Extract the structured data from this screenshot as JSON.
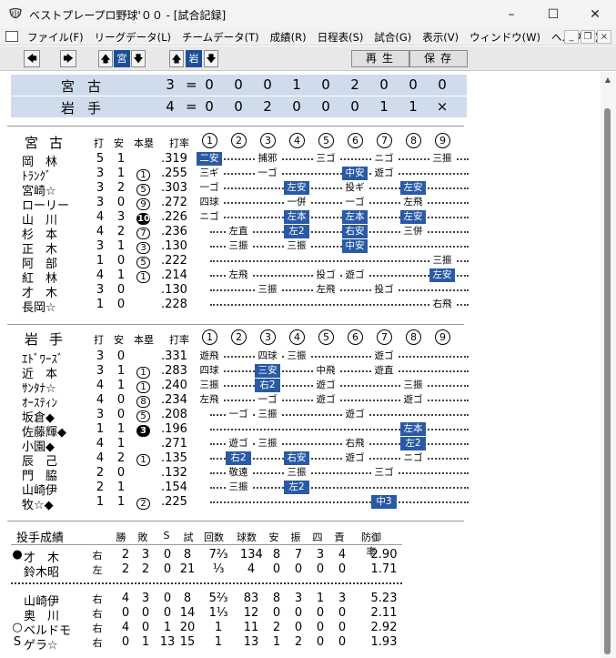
{
  "window": {
    "title": "ベストプレープロ野球'００ - [試合記録]"
  },
  "menu": [
    "ファイル(F)",
    "リーグデータ(L)",
    "チームデータ(T)",
    "成績(R)",
    "日程表(S)",
    "試合(G)",
    "表示(V)",
    "ウィンドウ(W)",
    "ヘルプ(H)"
  ],
  "toolbar": {
    "team_a": "宮",
    "team_b": "岩",
    "play": "再生",
    "save": "保存"
  },
  "score": {
    "rows": [
      {
        "team": "宮古",
        "runs": "3",
        "eq": "=",
        "innings": [
          "0",
          "0",
          "0",
          "1",
          "0",
          "2",
          "0",
          "0",
          "0"
        ]
      },
      {
        "team": "岩手",
        "runs": "4",
        "eq": "=",
        "innings": [
          "0",
          "0",
          "2",
          "0",
          "0",
          "0",
          "1",
          "1",
          "×"
        ]
      }
    ]
  },
  "batting_headers": {
    "ab": "打",
    "h": "安",
    "hr": "本塁",
    "avg": "打率",
    "innings": [
      "1",
      "2",
      "3",
      "4",
      "5",
      "6",
      "7",
      "8",
      "9"
    ]
  },
  "team1": {
    "name": "宮古",
    "players": [
      {
        "name": "岡　林",
        "ab": "5",
        "h": "1",
        "hr": "",
        "avg": ".319",
        "res": [
          {
            "inn": 1,
            "t": "二安",
            "hit": true
          },
          {
            "inn": 3,
            "t": "捕邪"
          },
          {
            "inn": 5,
            "t": "三ゴ"
          },
          {
            "inn": 7,
            "t": "ニゴ"
          },
          {
            "inn": 9,
            "t": "三振"
          }
        ]
      },
      {
        "name": "ﾄﾗﾝｸﾞ",
        "ab": "3",
        "h": "1",
        "hr": "1",
        "avg": ".255",
        "res": [
          {
            "inn": 1,
            "t": "三ギ"
          },
          {
            "inn": 3,
            "t": "一ゴ"
          },
          {
            "inn": 6,
            "t": "中安",
            "hit": true
          },
          {
            "inn": 7,
            "t": "遊ゴ"
          }
        ]
      },
      {
        "name": "宮崎☆",
        "ab": "3",
        "h": "2",
        "hr": "5",
        "avg": ".303",
        "res": [
          {
            "inn": 1,
            "t": "一ゴ"
          },
          {
            "inn": 4,
            "t": "左安",
            "hit": true
          },
          {
            "inn": 6,
            "t": "投ギ"
          },
          {
            "inn": 8,
            "t": "左安",
            "hit": true
          }
        ]
      },
      {
        "name": "ローリー",
        "ab": "3",
        "h": "0",
        "hr": "9",
        "avg": ".272",
        "res": [
          {
            "inn": 1,
            "t": "四球"
          },
          {
            "inn": 4,
            "t": "一併"
          },
          {
            "inn": 6,
            "t": "一ゴ"
          },
          {
            "inn": 8,
            "t": "左飛"
          }
        ]
      },
      {
        "name": "山　川",
        "ab": "4",
        "h": "3",
        "hr": "10",
        "hrBlack": true,
        "avg": ".226",
        "res": [
          {
            "inn": 1,
            "t": "ニゴ"
          },
          {
            "inn": 4,
            "t": "左本",
            "hit": true
          },
          {
            "inn": 6,
            "t": "左本",
            "hit": true
          },
          {
            "inn": 8,
            "t": "左安",
            "hit": true
          }
        ]
      },
      {
        "name": "杉　本",
        "ab": "4",
        "h": "2",
        "hr": "7",
        "avg": ".236",
        "res": [
          {
            "inn": 2,
            "t": "左直"
          },
          {
            "inn": 4,
            "t": "左2",
            "hit": true
          },
          {
            "inn": 6,
            "t": "右安",
            "hit": true
          },
          {
            "inn": 8,
            "t": "三併"
          }
        ]
      },
      {
        "name": "正　木",
        "ab": "3",
        "h": "1",
        "hr": "3",
        "avg": ".130",
        "res": [
          {
            "inn": 2,
            "t": "三振"
          },
          {
            "inn": 4,
            "t": "三振"
          },
          {
            "inn": 6,
            "t": "中安",
            "hit": true
          }
        ]
      },
      {
        "name": "阿　部",
        "ab": "1",
        "h": "0",
        "hr": "5",
        "avg": ".222",
        "res": [
          {
            "inn": 9,
            "t": "三振"
          }
        ]
      },
      {
        "name": "紅　林",
        "ab": "4",
        "h": "1",
        "hr": "1",
        "avg": ".214",
        "res": [
          {
            "inn": 2,
            "t": "左飛"
          },
          {
            "inn": 5,
            "t": "投ゴ"
          },
          {
            "inn": 6,
            "t": "遊ゴ"
          },
          {
            "inn": 9,
            "t": "左安",
            "hit": true
          }
        ]
      },
      {
        "name": "才　木",
        "ab": "3",
        "h": "0",
        "hr": "",
        "avg": ".130",
        "res": [
          {
            "inn": 3,
            "t": "三振"
          },
          {
            "inn": 5,
            "t": "左飛"
          },
          {
            "inn": 7,
            "t": "投ゴ"
          }
        ]
      },
      {
        "name": "長岡☆",
        "ab": "1",
        "h": "0",
        "hr": "",
        "avg": ".228",
        "res": [
          {
            "inn": 9,
            "t": "右飛"
          }
        ]
      }
    ]
  },
  "team2": {
    "name": "岩手",
    "players": [
      {
        "name": "ｴﾄﾞﾜｰｽﾞ",
        "ab": "3",
        "h": "0",
        "hr": "",
        "avg": ".331",
        "res": [
          {
            "inn": 1,
            "t": "遊飛"
          },
          {
            "inn": 3,
            "t": "四球"
          },
          {
            "inn": 4,
            "t": "三振"
          },
          {
            "inn": 7,
            "t": "遊ゴ"
          }
        ]
      },
      {
        "name": "近　本",
        "ab": "3",
        "h": "1",
        "hr": "1",
        "avg": ".283",
        "res": [
          {
            "inn": 1,
            "t": "四球"
          },
          {
            "inn": 3,
            "t": "三安",
            "hit": true
          },
          {
            "inn": 5,
            "t": "中飛"
          },
          {
            "inn": 7,
            "t": "遊直"
          }
        ]
      },
      {
        "name": "ｻﾝﾀﾅ☆",
        "ab": "4",
        "h": "1",
        "hr": "1",
        "avg": ".240",
        "res": [
          {
            "inn": 1,
            "t": "三振"
          },
          {
            "inn": 3,
            "t": "右2",
            "hit": true
          },
          {
            "inn": 5,
            "t": "遊ゴ"
          },
          {
            "inn": 8,
            "t": "三振"
          }
        ]
      },
      {
        "name": "ｵｰｽﾃｨﾝ",
        "ab": "4",
        "h": "0",
        "hr": "8",
        "avg": ".234",
        "res": [
          {
            "inn": 1,
            "t": "左飛"
          },
          {
            "inn": 3,
            "t": "一ゴ"
          },
          {
            "inn": 5,
            "t": "遊ゴ"
          },
          {
            "inn": 8,
            "t": "遊ゴ"
          }
        ]
      },
      {
        "name": "坂倉◆",
        "ab": "3",
        "h": "0",
        "hr": "5",
        "avg": ".208",
        "res": [
          {
            "inn": 2,
            "t": "一ゴ"
          },
          {
            "inn": 3,
            "t": "三振"
          },
          {
            "inn": 6,
            "t": "遊ゴ"
          }
        ]
      },
      {
        "name": "佐藤輝◆",
        "ab": "1",
        "h": "1",
        "hr": "3",
        "hrBlack": true,
        "avg": ".196",
        "res": [
          {
            "inn": 8,
            "t": "左本",
            "hit": true
          }
        ]
      },
      {
        "name": "小園◆",
        "ab": "4",
        "h": "1",
        "hr": "",
        "avg": ".271",
        "res": [
          {
            "inn": 2,
            "t": "遊ゴ"
          },
          {
            "inn": 3,
            "t": "三振"
          },
          {
            "inn": 6,
            "t": "右飛"
          },
          {
            "inn": 8,
            "t": "左2",
            "hit": true
          }
        ]
      },
      {
        "name": "辰　己",
        "ab": "4",
        "h": "2",
        "hr": "1",
        "avg": ".135",
        "res": [
          {
            "inn": 2,
            "t": "右2",
            "hit": true
          },
          {
            "inn": 4,
            "t": "右安",
            "hit": true
          },
          {
            "inn": 6,
            "t": "遊ゴ"
          },
          {
            "inn": 8,
            "t": "ニゴ"
          }
        ]
      },
      {
        "name": "門　脇",
        "ab": "2",
        "h": "0",
        "hr": "",
        "avg": ".132",
        "res": [
          {
            "inn": 2,
            "t": "敬遠"
          },
          {
            "inn": 4,
            "t": "三振"
          },
          {
            "inn": 7,
            "t": "三ゴ"
          }
        ]
      },
      {
        "name": "山崎伊",
        "ab": "2",
        "h": "1",
        "hr": "",
        "avg": ".154",
        "res": [
          {
            "inn": 2,
            "t": "三振"
          },
          {
            "inn": 4,
            "t": "左2",
            "hit": true
          }
        ]
      },
      {
        "name": "牧☆◆",
        "ab": "1",
        "h": "1",
        "hr": "2",
        "avg": ".225",
        "res": [
          {
            "inn": 7,
            "t": "中3",
            "hit": true
          }
        ]
      }
    ]
  },
  "pitching": {
    "title": "投手成績",
    "headers": [
      "勝",
      "敗",
      "S",
      "試",
      "回数",
      "球数",
      "安",
      "振",
      "四",
      "責",
      "防御率"
    ],
    "team1": [
      {
        "mark": "●",
        "name": "才　木",
        "hand": "右",
        "w": "2",
        "l": "3",
        "s": "0",
        "g": "8",
        "ip": "7⅔",
        "np": "134",
        "h": "8",
        "k": "7",
        "bb": "3",
        "er": "4",
        "era": "2.90"
      },
      {
        "mark": "",
        "name": "鈴木昭",
        "hand": "左",
        "w": "2",
        "l": "2",
        "s": "0",
        "g": "21",
        "ip": "⅓",
        "np": "4",
        "h": "0",
        "k": "0",
        "bb": "0",
        "er": "0",
        "era": "1.71"
      }
    ],
    "team2": [
      {
        "mark": "",
        "name": "山崎伊",
        "hand": "右",
        "w": "4",
        "l": "3",
        "s": "0",
        "g": "8",
        "ip": "5⅔",
        "np": "83",
        "h": "8",
        "k": "3",
        "bb": "1",
        "er": "3",
        "era": "5.23"
      },
      {
        "mark": "",
        "name": "奥　川",
        "hand": "右",
        "w": "0",
        "l": "0",
        "s": "0",
        "g": "14",
        "ip": "1⅓",
        "np": "12",
        "h": "0",
        "k": "0",
        "bb": "0",
        "er": "0",
        "era": "2.11"
      },
      {
        "mark": "○",
        "name": "ベルドモ",
        "hand": "右",
        "w": "4",
        "l": "0",
        "s": "1",
        "g": "20",
        "ip": "1",
        "np": "11",
        "h": "2",
        "k": "0",
        "bb": "0",
        "er": "0",
        "era": "2.92"
      },
      {
        "mark": "S",
        "name": "ゲラ☆",
        "hand": "右",
        "w": "0",
        "l": "1",
        "s": "13",
        "g": "15",
        "ip": "1",
        "np": "13",
        "h": "1",
        "k": "2",
        "bb": "0",
        "er": "0",
        "era": "1.93"
      }
    ]
  }
}
